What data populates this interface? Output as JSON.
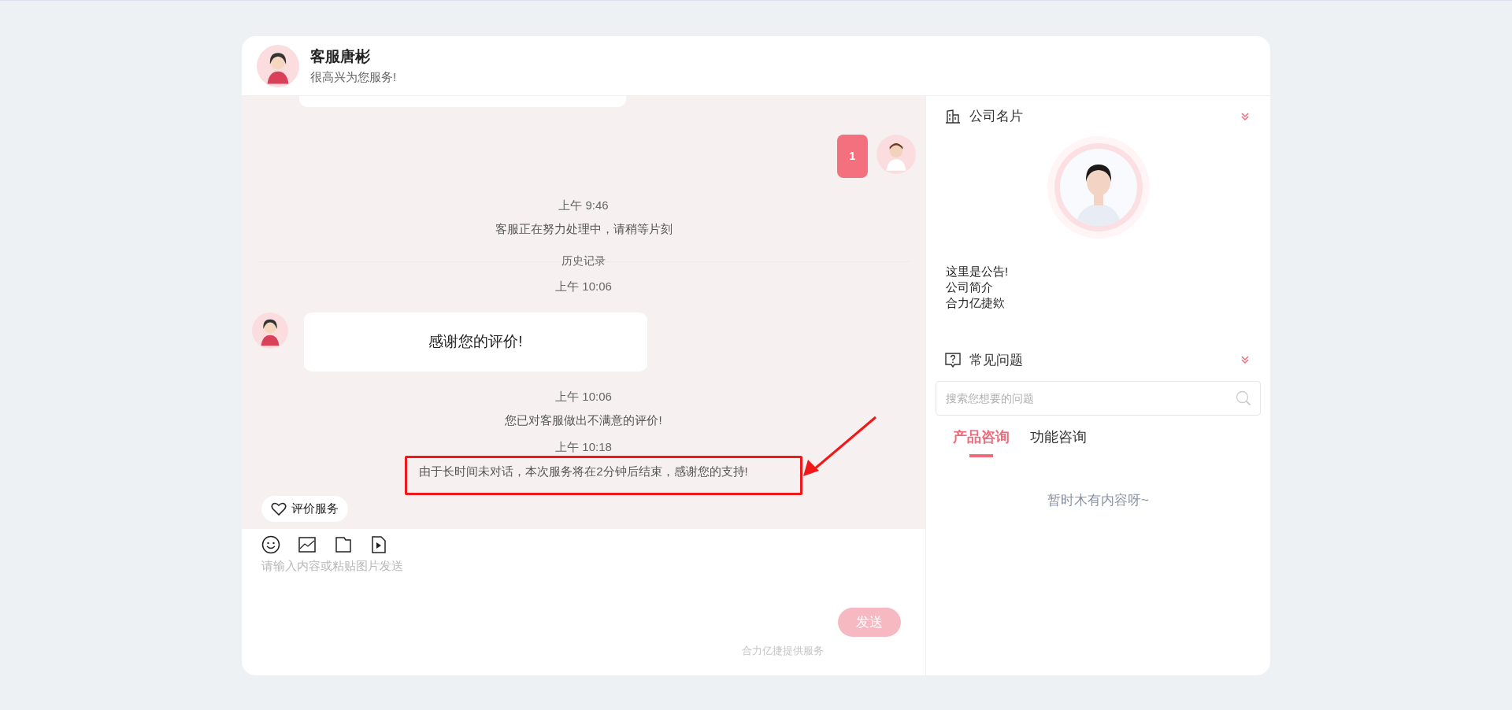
{
  "agent": {
    "name": "客服唐彬",
    "greeting": "很高兴为您服务!"
  },
  "messages": [
    {
      "kind": "partial"
    },
    {
      "kind": "user",
      "text": "1"
    },
    {
      "kind": "system",
      "time": "上午 9:46",
      "text": "客服正在努力处理中，请稍等片刻",
      "highlighted": false
    },
    {
      "kind": "divider",
      "label": "历史记录"
    },
    {
      "kind": "system",
      "time": "上午 10:06"
    },
    {
      "kind": "agent",
      "text": "感谢您的评价!"
    },
    {
      "kind": "system",
      "time": "上午 10:06",
      "text": "您已对客服做出不满意的评价!",
      "highlighted": false
    },
    {
      "kind": "system",
      "time": "上午 10:18",
      "text": "由于长时间未对话，本次服务将在2分钟后结束，感谢您的支持!",
      "highlighted": true
    }
  ],
  "rate_button": "评价服务",
  "composer": {
    "placeholder": "请输入内容或粘贴图片发送",
    "send": "发送",
    "send_disabled": true
  },
  "footer": "合力亿捷提供服务",
  "company_card": {
    "title": "公司名片",
    "lines": [
      "这里是公告!",
      "公司简介",
      "合力亿捷欸"
    ]
  },
  "faq": {
    "title": "常见问题",
    "search_placeholder": "搜索您想要的问题",
    "tabs": [
      {
        "label": "产品咨询",
        "selected": true
      },
      {
        "label": "功能咨询",
        "selected": false
      }
    ],
    "empty_text": "暂时木有内容呀~"
  }
}
